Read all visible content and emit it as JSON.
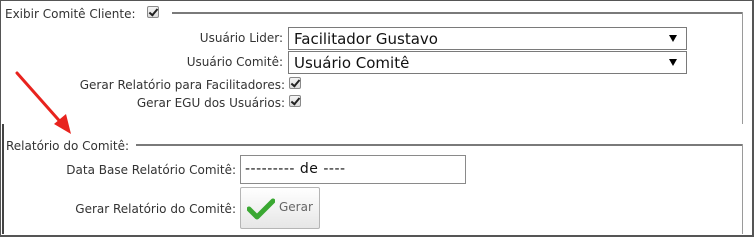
{
  "top_section": {
    "exibir_label": "Exibir Comitê Cliente:",
    "exibir_checked": true
  },
  "fields": {
    "usuario_lider_label": "Usuário Lider:",
    "usuario_lider_value": "Facilitador Gustavo",
    "usuario_comite_label": "Usuário Comitê:",
    "usuario_comite_value": "Usuário Comitê",
    "gerar_relatorio_facilitadores_label": "Gerar Relatório para Facilitadores:",
    "gerar_relatorio_facilitadores_checked": true,
    "gerar_egu_label": "Gerar EGU dos Usuários:",
    "gerar_egu_checked": true
  },
  "relatorio_section": {
    "title": "Relatório do Comitê:",
    "data_base_label": "Data Base Relatório Comitê:",
    "data_base_value": "--------- de ----",
    "gerar_label": "Gerar Relatório do Comitê:",
    "gerar_button": "Gerar"
  },
  "colors": {
    "annotation_arrow": "#e8231e",
    "check_icon": "#3aa832"
  }
}
